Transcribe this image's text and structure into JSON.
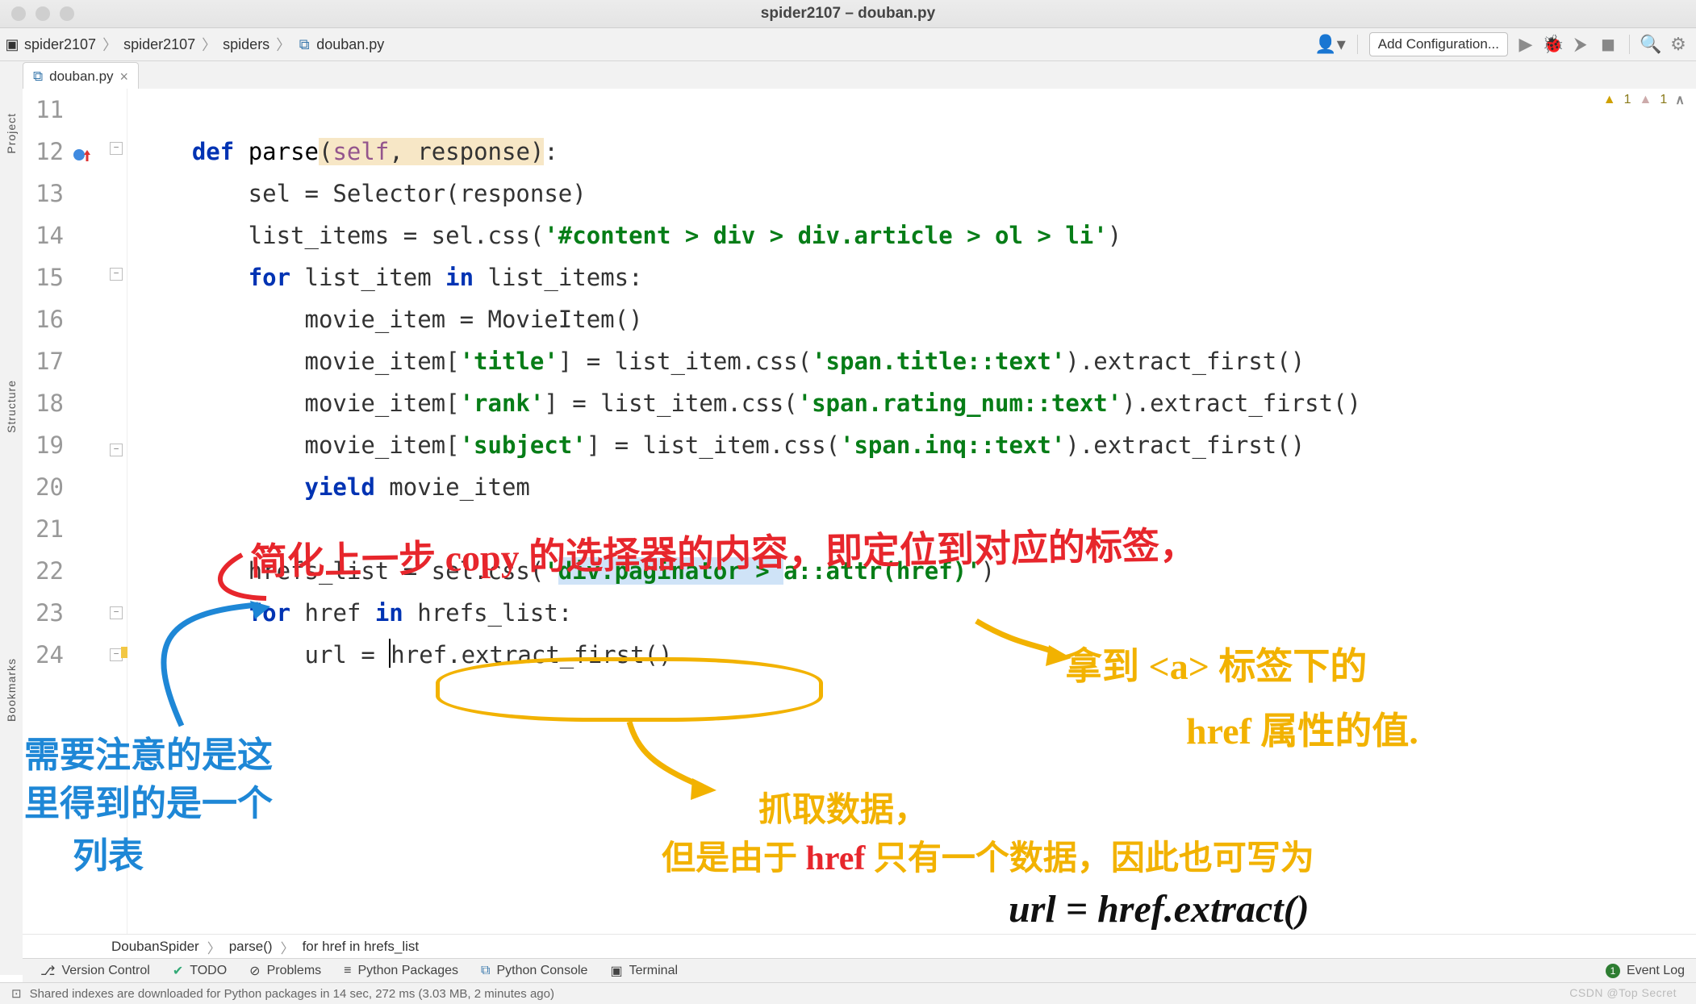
{
  "window": {
    "title": "spider2107 – douban.py"
  },
  "breadcrumbs": {
    "items": [
      "spider2107",
      "spider2107",
      "spiders",
      "douban.py"
    ]
  },
  "toolbar": {
    "add_config": "Add Configuration...",
    "icons": {
      "user": "user-icon",
      "run": "run-icon",
      "debug": "debug-icon",
      "coverage": "coverage-icon",
      "stop": "stop-icon",
      "search": "search-icon",
      "settings": "gear-icon"
    }
  },
  "tabs": {
    "open": [
      {
        "name": "douban.py",
        "close": "×"
      }
    ]
  },
  "left_strip": {
    "labels": [
      "Project",
      "Structure",
      "Bookmarks"
    ]
  },
  "editor": {
    "first_line_no": 11,
    "lines": [
      {
        "no": 11,
        "plain": ""
      },
      {
        "no": 12,
        "segments": [
          {
            "t": "    ",
            "c": ""
          },
          {
            "t": "def ",
            "c": "kw"
          },
          {
            "t": "parse",
            "c": "fn"
          },
          {
            "t": "(",
            "c": "paramhl"
          },
          {
            "t": "self",
            "c": "self paramhl"
          },
          {
            "t": ", response)",
            "c": "paramhl"
          },
          {
            "t": ":",
            "c": ""
          }
        ]
      },
      {
        "no": 13,
        "segments": [
          {
            "t": "        sel = Selector(response)",
            "c": ""
          }
        ]
      },
      {
        "no": 14,
        "segments": [
          {
            "t": "        list_items = sel.css(",
            "c": ""
          },
          {
            "t": "'#content > div > div.article > ol > li'",
            "c": "str"
          },
          {
            "t": ")",
            "c": ""
          }
        ]
      },
      {
        "no": 15,
        "segments": [
          {
            "t": "        ",
            "c": ""
          },
          {
            "t": "for ",
            "c": "kw"
          },
          {
            "t": "list_item ",
            "c": ""
          },
          {
            "t": "in ",
            "c": "kw"
          },
          {
            "t": "list_items:",
            "c": ""
          }
        ]
      },
      {
        "no": 16,
        "segments": [
          {
            "t": "            movie_item = MovieItem()",
            "c": ""
          }
        ]
      },
      {
        "no": 17,
        "segments": [
          {
            "t": "            movie_item[",
            "c": ""
          },
          {
            "t": "'title'",
            "c": "str"
          },
          {
            "t": "] = list_item.css(",
            "c": ""
          },
          {
            "t": "'span.title::text'",
            "c": "str"
          },
          {
            "t": ").extract_first()",
            "c": ""
          }
        ]
      },
      {
        "no": 18,
        "segments": [
          {
            "t": "            movie_item[",
            "c": ""
          },
          {
            "t": "'rank'",
            "c": "str"
          },
          {
            "t": "] = list_item.css(",
            "c": ""
          },
          {
            "t": "'span.rating_num::text'",
            "c": "str"
          },
          {
            "t": ").extract_first()",
            "c": ""
          }
        ]
      },
      {
        "no": 19,
        "segments": [
          {
            "t": "            movie_item[",
            "c": ""
          },
          {
            "t": "'subject'",
            "c": "str"
          },
          {
            "t": "] = list_item.css(",
            "c": ""
          },
          {
            "t": "'span.inq::text'",
            "c": "str"
          },
          {
            "t": ").extract_first()",
            "c": ""
          }
        ]
      },
      {
        "no": 20,
        "segments": [
          {
            "t": "            ",
            "c": ""
          },
          {
            "t": "yield ",
            "c": "kw"
          },
          {
            "t": "movie_item",
            "c": ""
          }
        ]
      },
      {
        "no": 21,
        "plain": ""
      },
      {
        "no": 22,
        "segments": [
          {
            "t": "        hrefs_list = sel.css(",
            "c": ""
          },
          {
            "t": "'",
            "c": "str"
          },
          {
            "t": "div.paginator > ",
            "c": "str selhl"
          },
          {
            "t": "a::attr(href)'",
            "c": "str"
          },
          {
            "t": ")",
            "c": ""
          }
        ]
      },
      {
        "no": 23,
        "segments": [
          {
            "t": "        ",
            "c": ""
          },
          {
            "t": "for ",
            "c": "kw"
          },
          {
            "t": "href ",
            "c": ""
          },
          {
            "t": "in ",
            "c": "kw"
          },
          {
            "t": "hrefs_list:",
            "c": ""
          }
        ]
      },
      {
        "no": 24,
        "segments": [
          {
            "t": "            url = ",
            "c": ""
          },
          {
            "t": "|",
            "c": "caret"
          },
          {
            "t": "href.extract_first()",
            "c": ""
          }
        ]
      }
    ],
    "highlight_line_no": 24
  },
  "nav_crumbs": {
    "items": [
      "DoubanSpider",
      "parse()",
      "for href in hrefs_list"
    ]
  },
  "bottom_tools": {
    "items": [
      {
        "icon": "git-icon",
        "label": "Version Control"
      },
      {
        "icon": "todo-icon",
        "label": "TODO"
      },
      {
        "icon": "problems-icon",
        "label": "Problems"
      },
      {
        "icon": "packages-icon",
        "label": "Python Packages"
      },
      {
        "icon": "console-icon",
        "label": "Python Console"
      },
      {
        "icon": "terminal-icon",
        "label": "Terminal"
      }
    ],
    "right": {
      "icon": "event-icon",
      "label": "Event Log",
      "badge": "1"
    }
  },
  "status": {
    "left_icon": "speech-icon",
    "message": "Shared indexes are downloaded for Python packages in 14 sec, 272 ms (3.03 MB, 2 minutes ago)"
  },
  "warnings": {
    "a": "1",
    "b": "1",
    "up": "^"
  },
  "watermark": "CSDN @Top Secret",
  "annotations": {
    "red_top": "简化上一步 copy 的选择器的内容，即定位到对应的标签，",
    "blue_left_1": "需要注意的是这",
    "blue_left_2": "里得到的是一个",
    "blue_left_3": "列表",
    "orange_right_1": "拿到 <a> 标签下的",
    "orange_right_2": "href 属性的值.",
    "orange_mid_1": "抓取数据，",
    "orange_mid_2_a": "但是由于 ",
    "orange_mid_2_b": "href",
    "orange_mid_2_c": " 只有一个数据，因此也可写为",
    "black_bottom": "url = href.extract()"
  }
}
